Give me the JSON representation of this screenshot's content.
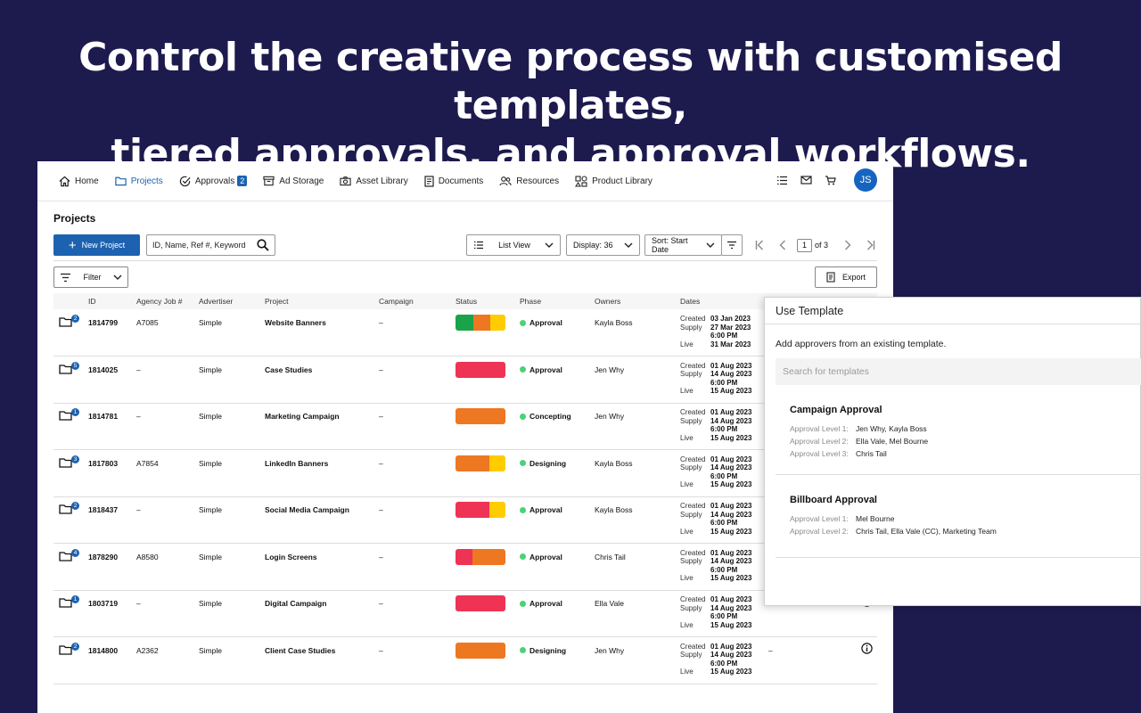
{
  "hero": {
    "line1": "Control the creative process with customised templates,",
    "line2": "tiered approvals, and approval workflows."
  },
  "nav": {
    "items": [
      {
        "label": "Home",
        "icon": "home-icon"
      },
      {
        "label": "Projects",
        "icon": "folder-icon",
        "active": true
      },
      {
        "label": "Approvals",
        "icon": "check-circle-icon",
        "badge": "2"
      },
      {
        "label": "Ad Storage",
        "icon": "storage-icon"
      },
      {
        "label": "Asset Library",
        "icon": "camera-icon"
      },
      {
        "label": "Documents",
        "icon": "document-icon"
      },
      {
        "label": "Resources",
        "icon": "people-icon"
      },
      {
        "label": "Product Library",
        "icon": "shapes-icon"
      }
    ],
    "avatar": "JS",
    "right_icons": [
      "list-icon",
      "mail-icon",
      "cart-icon"
    ]
  },
  "projects": {
    "title": "Projects",
    "new_button": "New Project",
    "search_placeholder": "ID, Name, Ref #, Keyword",
    "view_label": "List View",
    "display_label": "Display: 36",
    "sort_label": "Sort: Start Date",
    "page_current": "1",
    "page_total": "of 3",
    "filter_label": "Filter",
    "export_label": "Export"
  },
  "table": {
    "headers": [
      "ID",
      "Agency Job #",
      "Advertiser",
      "Project",
      "Campaign",
      "Status",
      "Phase",
      "Owners",
      "Dates"
    ],
    "date_labels": {
      "created": "Created",
      "supply": "Supply",
      "live": "Live"
    },
    "rows": [
      {
        "badge": "2",
        "id": "1814799",
        "job": "A7085",
        "advertiser": "Simple",
        "project": "Website Banners",
        "campaign": "–",
        "status": [
          [
            "#1aa34a",
            36
          ],
          [
            "#ee7722",
            34
          ],
          [
            "#ffcc00",
            30
          ]
        ],
        "phase": "Approval",
        "owner": "Kayla Boss",
        "created": "03 Jan 2023",
        "supply": "27 Mar 2023",
        "supply_time": "6:00 PM",
        "live": "31 Mar 2023",
        "extra": "",
        "info": false
      },
      {
        "badge": "5",
        "id": "1814025",
        "job": "–",
        "advertiser": "Simple",
        "project": "Case Studies",
        "campaign": "–",
        "status": [
          [
            "#ee3355",
            100
          ]
        ],
        "phase": "Approval",
        "owner": "Jen Why",
        "created": "01 Aug 2023",
        "supply": "14 Aug 2023",
        "supply_time": "6:00 PM",
        "live": "15 Aug 2023",
        "extra": "",
        "info": false
      },
      {
        "badge": "1",
        "id": "1814781",
        "job": "–",
        "advertiser": "Simple",
        "project": "Marketing Campaign",
        "campaign": "–",
        "status": [
          [
            "#ee7722",
            100
          ]
        ],
        "phase": "Concepting",
        "owner": "Jen Why",
        "created": "01 Aug 2023",
        "supply": "14 Aug 2023",
        "supply_time": "6:00 PM",
        "live": "15 Aug 2023",
        "extra": "",
        "info": false
      },
      {
        "badge": "3",
        "id": "1817803",
        "job": "A7854",
        "advertiser": "Simple",
        "project": "LinkedIn Banners",
        "campaign": "–",
        "status": [
          [
            "#ee7722",
            68
          ],
          [
            "#ffcc00",
            32
          ]
        ],
        "phase": "Designing",
        "owner": "Kayla Boss",
        "created": "01 Aug 2023",
        "supply": "14 Aug 2023",
        "supply_time": "6:00 PM",
        "live": "15 Aug 2023",
        "extra": "",
        "info": false
      },
      {
        "badge": "2",
        "id": "1818437",
        "job": "–",
        "advertiser": "Simple",
        "project": "Social Media Campaign",
        "campaign": "–",
        "status": [
          [
            "#ee3355",
            68
          ],
          [
            "#ffcc00",
            32
          ]
        ],
        "phase": "Approval",
        "owner": "Kayla Boss",
        "created": "01 Aug 2023",
        "supply": "14 Aug 2023",
        "supply_time": "6:00 PM",
        "live": "15 Aug 2023",
        "extra": "",
        "info": false
      },
      {
        "badge": "4",
        "id": "1878290",
        "job": "A8580",
        "advertiser": "Simple",
        "project": "Login Screens",
        "campaign": "–",
        "status": [
          [
            "#ee3355",
            34
          ],
          [
            "#ee7722",
            66
          ]
        ],
        "phase": "Approval",
        "owner": "Chris Tail",
        "created": "01 Aug 2023",
        "supply": "14 Aug 2023",
        "supply_time": "6:00 PM",
        "live": "15 Aug 2023",
        "extra": "",
        "info": false
      },
      {
        "badge": "1",
        "id": "1803719",
        "job": "–",
        "advertiser": "Simple",
        "project": "Digital Campaign",
        "campaign": "–",
        "status": [
          [
            "#ee3355",
            100
          ]
        ],
        "phase": "Approval",
        "owner": "Ella Vale",
        "created": "01 Aug 2023",
        "supply": "14 Aug 2023",
        "supply_time": "6:00 PM",
        "live": "15 Aug 2023",
        "extra": "",
        "info": true
      },
      {
        "badge": "2",
        "id": "1814800",
        "job": "A2362",
        "advertiser": "Simple",
        "project": "Client Case Studies",
        "campaign": "–",
        "status": [
          [
            "#ee7722",
            100
          ]
        ],
        "phase": "Designing",
        "owner": "Jen Why",
        "created": "01 Aug 2023",
        "supply": "14 Aug 2023",
        "supply_time": "6:00 PM",
        "live": "15 Aug 2023",
        "extra": "–",
        "info": true
      }
    ]
  },
  "template_panel": {
    "title": "Use Template",
    "intro": "Add approvers from an existing template.",
    "search_placeholder": "Search for templates",
    "templates": [
      {
        "name": "Campaign Approval",
        "levels": [
          {
            "label": "Approval Level 1:",
            "value": "Jen Why, Kayla Boss"
          },
          {
            "label": "Approval Level 2:",
            "value": "Ella Vale, Mel Bourne"
          },
          {
            "label": "Approval Level 3:",
            "value": "Chris Tail"
          }
        ]
      },
      {
        "name": "Billboard Approval",
        "levels": [
          {
            "label": "Approval Level 1:",
            "value": "Mel Bourne"
          },
          {
            "label": "Approval Level 2:",
            "value": "Chris Tail, Ella Vale (CC), Marketing Team"
          }
        ]
      }
    ]
  }
}
